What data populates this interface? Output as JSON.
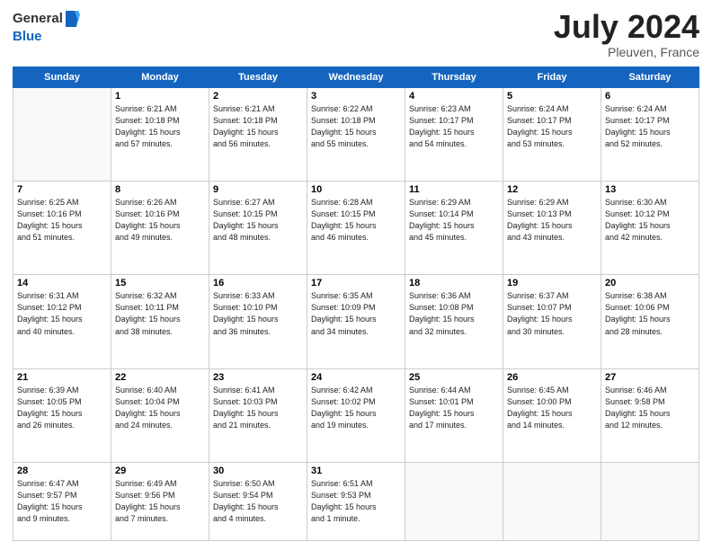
{
  "header": {
    "logo_line1": "General",
    "logo_line2": "Blue",
    "title": "July 2024",
    "location": "Pleuven, France"
  },
  "days_of_week": [
    "Sunday",
    "Monday",
    "Tuesday",
    "Wednesday",
    "Thursday",
    "Friday",
    "Saturday"
  ],
  "weeks": [
    [
      {
        "day": "",
        "info": ""
      },
      {
        "day": "1",
        "info": "Sunrise: 6:21 AM\nSunset: 10:18 PM\nDaylight: 15 hours\nand 57 minutes."
      },
      {
        "day": "2",
        "info": "Sunrise: 6:21 AM\nSunset: 10:18 PM\nDaylight: 15 hours\nand 56 minutes."
      },
      {
        "day": "3",
        "info": "Sunrise: 6:22 AM\nSunset: 10:18 PM\nDaylight: 15 hours\nand 55 minutes."
      },
      {
        "day": "4",
        "info": "Sunrise: 6:23 AM\nSunset: 10:17 PM\nDaylight: 15 hours\nand 54 minutes."
      },
      {
        "day": "5",
        "info": "Sunrise: 6:24 AM\nSunset: 10:17 PM\nDaylight: 15 hours\nand 53 minutes."
      },
      {
        "day": "6",
        "info": "Sunrise: 6:24 AM\nSunset: 10:17 PM\nDaylight: 15 hours\nand 52 minutes."
      }
    ],
    [
      {
        "day": "7",
        "info": "Sunrise: 6:25 AM\nSunset: 10:16 PM\nDaylight: 15 hours\nand 51 minutes."
      },
      {
        "day": "8",
        "info": "Sunrise: 6:26 AM\nSunset: 10:16 PM\nDaylight: 15 hours\nand 49 minutes."
      },
      {
        "day": "9",
        "info": "Sunrise: 6:27 AM\nSunset: 10:15 PM\nDaylight: 15 hours\nand 48 minutes."
      },
      {
        "day": "10",
        "info": "Sunrise: 6:28 AM\nSunset: 10:15 PM\nDaylight: 15 hours\nand 46 minutes."
      },
      {
        "day": "11",
        "info": "Sunrise: 6:29 AM\nSunset: 10:14 PM\nDaylight: 15 hours\nand 45 minutes."
      },
      {
        "day": "12",
        "info": "Sunrise: 6:29 AM\nSunset: 10:13 PM\nDaylight: 15 hours\nand 43 minutes."
      },
      {
        "day": "13",
        "info": "Sunrise: 6:30 AM\nSunset: 10:12 PM\nDaylight: 15 hours\nand 42 minutes."
      }
    ],
    [
      {
        "day": "14",
        "info": "Sunrise: 6:31 AM\nSunset: 10:12 PM\nDaylight: 15 hours\nand 40 minutes."
      },
      {
        "day": "15",
        "info": "Sunrise: 6:32 AM\nSunset: 10:11 PM\nDaylight: 15 hours\nand 38 minutes."
      },
      {
        "day": "16",
        "info": "Sunrise: 6:33 AM\nSunset: 10:10 PM\nDaylight: 15 hours\nand 36 minutes."
      },
      {
        "day": "17",
        "info": "Sunrise: 6:35 AM\nSunset: 10:09 PM\nDaylight: 15 hours\nand 34 minutes."
      },
      {
        "day": "18",
        "info": "Sunrise: 6:36 AM\nSunset: 10:08 PM\nDaylight: 15 hours\nand 32 minutes."
      },
      {
        "day": "19",
        "info": "Sunrise: 6:37 AM\nSunset: 10:07 PM\nDaylight: 15 hours\nand 30 minutes."
      },
      {
        "day": "20",
        "info": "Sunrise: 6:38 AM\nSunset: 10:06 PM\nDaylight: 15 hours\nand 28 minutes."
      }
    ],
    [
      {
        "day": "21",
        "info": "Sunrise: 6:39 AM\nSunset: 10:05 PM\nDaylight: 15 hours\nand 26 minutes."
      },
      {
        "day": "22",
        "info": "Sunrise: 6:40 AM\nSunset: 10:04 PM\nDaylight: 15 hours\nand 24 minutes."
      },
      {
        "day": "23",
        "info": "Sunrise: 6:41 AM\nSunset: 10:03 PM\nDaylight: 15 hours\nand 21 minutes."
      },
      {
        "day": "24",
        "info": "Sunrise: 6:42 AM\nSunset: 10:02 PM\nDaylight: 15 hours\nand 19 minutes."
      },
      {
        "day": "25",
        "info": "Sunrise: 6:44 AM\nSunset: 10:01 PM\nDaylight: 15 hours\nand 17 minutes."
      },
      {
        "day": "26",
        "info": "Sunrise: 6:45 AM\nSunset: 10:00 PM\nDaylight: 15 hours\nand 14 minutes."
      },
      {
        "day": "27",
        "info": "Sunrise: 6:46 AM\nSunset: 9:58 PM\nDaylight: 15 hours\nand 12 minutes."
      }
    ],
    [
      {
        "day": "28",
        "info": "Sunrise: 6:47 AM\nSunset: 9:57 PM\nDaylight: 15 hours\nand 9 minutes."
      },
      {
        "day": "29",
        "info": "Sunrise: 6:49 AM\nSunset: 9:56 PM\nDaylight: 15 hours\nand 7 minutes."
      },
      {
        "day": "30",
        "info": "Sunrise: 6:50 AM\nSunset: 9:54 PM\nDaylight: 15 hours\nand 4 minutes."
      },
      {
        "day": "31",
        "info": "Sunrise: 6:51 AM\nSunset: 9:53 PM\nDaylight: 15 hours\nand 1 minute."
      },
      {
        "day": "",
        "info": ""
      },
      {
        "day": "",
        "info": ""
      },
      {
        "day": "",
        "info": ""
      }
    ]
  ]
}
